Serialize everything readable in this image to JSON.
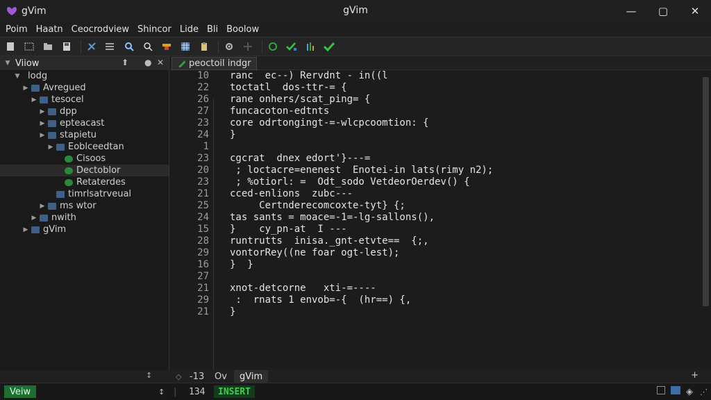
{
  "app": {
    "title": "gVim",
    "window_title": "gVim"
  },
  "menu": [
    "Poim",
    "Haatn",
    "Ceocrodview",
    "Shincor",
    "Lide",
    "Bli",
    "Boolow"
  ],
  "toolbar_icons": [
    "file-icon",
    "folder-icon",
    "open-icon",
    "save-icon",
    "cut-icon",
    "list-icon",
    "zoom-icon",
    "search-icon",
    "flag-icon",
    "grid-icon",
    "clipboard-icon",
    "gear-icon",
    "dim-icon",
    "refresh-icon",
    "run-icon",
    "bars-icon",
    "check-icon"
  ],
  "sidebar": {
    "header": "Viiow",
    "tree": [
      {
        "label": "lodg",
        "indent": 1,
        "twisty": "down",
        "icon": false
      },
      {
        "label": "Avregued",
        "indent": 2,
        "twisty": "right",
        "icon": true
      },
      {
        "label": "tesocel",
        "indent": 3,
        "twisty": "right",
        "icon": true
      },
      {
        "label": "dpp",
        "indent": 4,
        "twisty": "right",
        "icon": true
      },
      {
        "label": "epteacast",
        "indent": 4,
        "twisty": "right",
        "icon": true
      },
      {
        "label": "stapietu",
        "indent": 4,
        "twisty": "right",
        "icon": true
      },
      {
        "label": "Eoblceedtan",
        "indent": 5,
        "twisty": "right",
        "icon": true
      },
      {
        "label": "Cisoos",
        "indent": 6,
        "twisty": "",
        "icon": true
      },
      {
        "label": "Dectoblor",
        "indent": 6,
        "twisty": "",
        "icon": true
      },
      {
        "label": "Retaterdes",
        "indent": 6,
        "twisty": "",
        "icon": true
      },
      {
        "label": "timrlsatrveual",
        "indent": 5,
        "twisty": "",
        "icon": true
      },
      {
        "label": "ms wtor",
        "indent": 4,
        "twisty": "right",
        "icon": true
      },
      {
        "label": "nwith",
        "indent": 3,
        "twisty": "right",
        "icon": true
      },
      {
        "label": "gVim",
        "indent": 2,
        "twisty": "right",
        "icon": true
      }
    ]
  },
  "tab": {
    "label": "peoctoil indgr"
  },
  "editor": {
    "line_numbers": [
      "10",
      "22",
      "26",
      "27",
      "23",
      "24",
      "1",
      "23",
      "20",
      "23",
      "21",
      "25",
      "24",
      "15",
      "28",
      "29",
      "16",
      "27",
      "21",
      "29",
      "21"
    ],
    "lines": [
      "ranc  ec--) Rervdnt - in((l",
      "toctatl  dos-ttr-= {",
      "rane onhers/scat_ping= {",
      "funcacoton-edtnts",
      "core odrtongingt-=-wlcpcoomtion: {",
      "}",
      "",
      "cgcrat  dnex edort'}---=",
      " ; loctacre=enenest  Enotei-in lats(rimy n2);",
      " ; %otiorl: =  Odt_sodo VetdeorOerdev() {",
      "cced-enlions  zubc---",
      "     Certnderecomcoxte-tyt} {;",
      "tas sants = moace=-1=-lg-sallons(),",
      "}    cy_pn-at  I ---",
      "runtrutts  inisa._gnt-etvte==  {;,",
      "vontorRey((ne foar ogt-lest);",
      "}  }",
      "",
      "xnot-detcorne   xti-=----",
      " :  rnats 1 envob=-{  (hr==) {,",
      "}"
    ]
  },
  "side_footer": {
    "arrow": "↕"
  },
  "editor_footer": {
    "col_label": "-13",
    "mode_short": "Ov",
    "buffer": "gVim"
  },
  "status": {
    "view_label": "Veiw",
    "pos": "134",
    "mode": "INSERT"
  },
  "colors": {
    "accent_green": "#2fc940",
    "mode_fg": "#38d14a",
    "folder_blue": "#3f5f87"
  }
}
